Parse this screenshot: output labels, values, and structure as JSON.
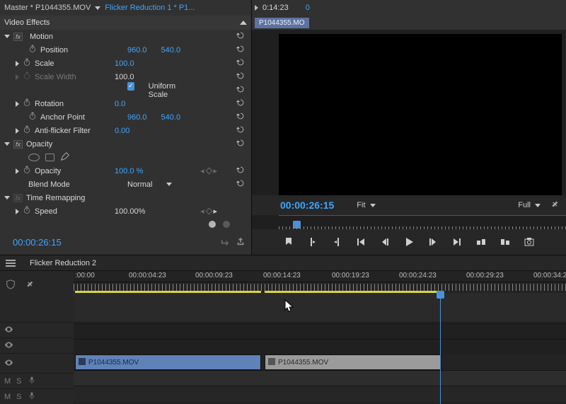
{
  "header": {
    "master_label": "Master * P1044355.MOV",
    "active_label": "Flicker Reduction 1 * P1...",
    "mini_time": "0:14:23",
    "mini_frame": "0",
    "source_tab": "P1044355.MO"
  },
  "effects": {
    "title": "Video Effects",
    "motion": {
      "label": "Motion",
      "position": {
        "label": "Position",
        "x": "960.0",
        "y": "540.0"
      },
      "scale": {
        "label": "Scale",
        "value": "100.0"
      },
      "scale_width": {
        "label": "Scale Width",
        "value": "100.0"
      },
      "uniform": {
        "label": "Uniform Scale"
      },
      "rotation": {
        "label": "Rotation",
        "value": "0.0"
      },
      "anchor": {
        "label": "Anchor Point",
        "x": "960.0",
        "y": "540.0"
      },
      "antiflicker": {
        "label": "Anti-flicker Filter",
        "value": "0.00"
      }
    },
    "opacity": {
      "label": "Opacity",
      "opacity_prop": {
        "label": "Opacity",
        "value": "100.0 %"
      },
      "blend": {
        "label": "Blend Mode",
        "value": "Normal"
      }
    },
    "time_remap": {
      "label": "Time Remapping",
      "speed": {
        "label": "Speed",
        "value": "100.00%"
      }
    },
    "current_time": "00:00:26:15"
  },
  "preview": {
    "time": "00:00:26:15",
    "zoom": "Fit",
    "quality": "Full"
  },
  "timeline": {
    "sequence_name": "Flicker Reduction 2",
    "ruler": [
      ":00:00",
      "00:00:04:23",
      "00:00:09:23",
      "00:00:14:23",
      "00:00:19:23",
      "00:00:24:23",
      "00:00:29:23",
      "00:00:34:2"
    ],
    "clip1": "P1044355.MOV",
    "clip2": "P1044355.MOV",
    "audio_m": "M",
    "audio_s": "S"
  }
}
